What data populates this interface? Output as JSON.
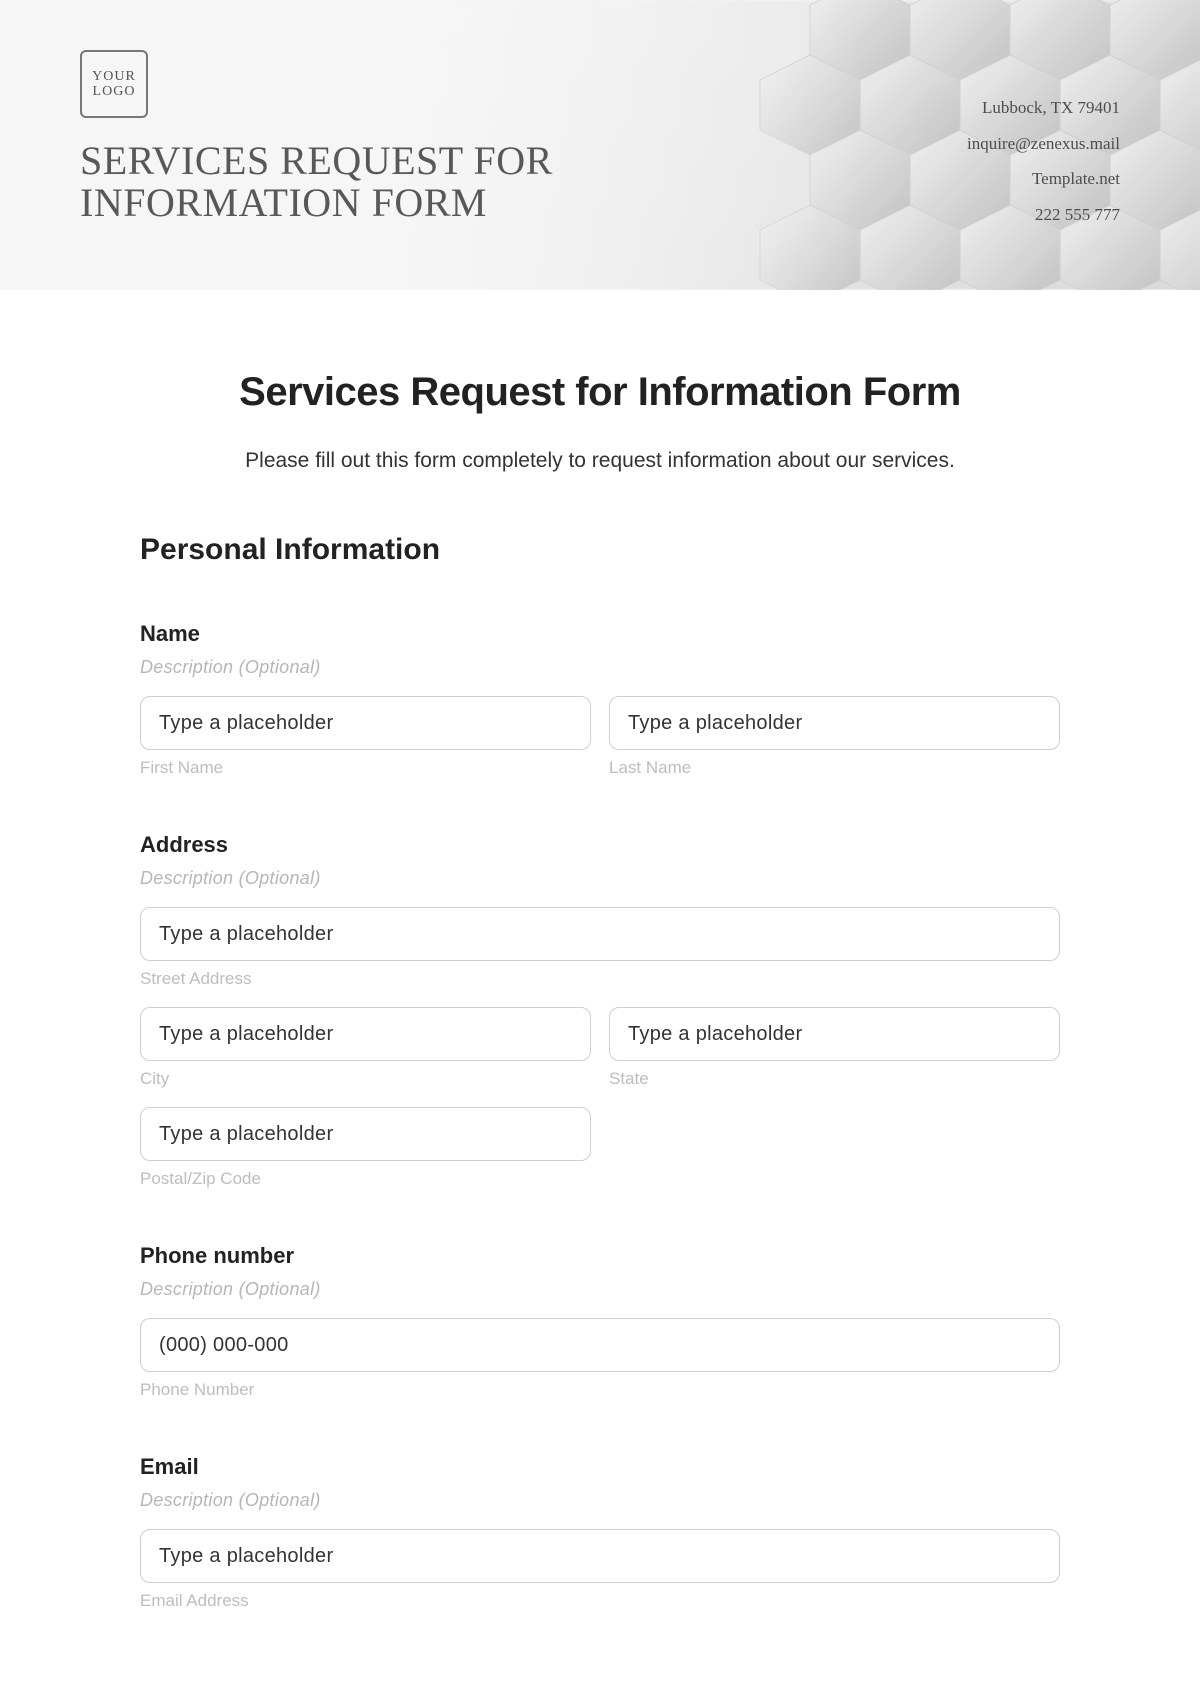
{
  "header": {
    "logo_text": "YOUR\nLOGO",
    "title": "SERVICES REQUEST FOR INFORMATION FORM",
    "contact": {
      "address": "Lubbock, TX 79401",
      "email": "inquire@zenexus.mail",
      "website": "Template.net",
      "phone": "222 555 777"
    }
  },
  "form": {
    "title": "Services Request for Information Form",
    "intro": "Please fill out this form completely to request information about our services.",
    "section_personal": "Personal Information",
    "desc_optional": "Description (Optional)",
    "generic_placeholder": "Type a placeholder",
    "name": {
      "label": "Name",
      "first_sub": "First Name",
      "last_sub": "Last Name"
    },
    "address": {
      "label": "Address",
      "street_sub": "Street Address",
      "city_sub": "City",
      "state_sub": "State",
      "postal_sub": "Postal/Zip Code"
    },
    "phone": {
      "label": "Phone number",
      "placeholder": "(000) 000-000",
      "sub": "Phone Number"
    },
    "email": {
      "label": "Email",
      "sub": "Email Address"
    }
  }
}
